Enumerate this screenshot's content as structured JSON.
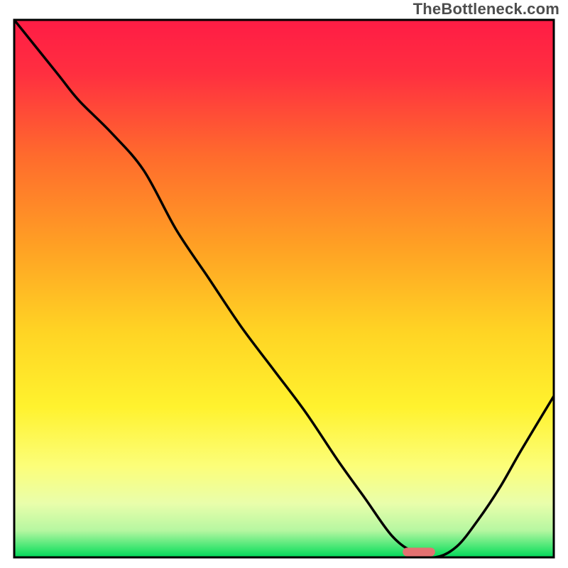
{
  "watermark": "TheBottleneck.com",
  "chart_data": {
    "type": "line",
    "title": "",
    "xlabel": "",
    "ylabel": "",
    "xlim": [
      0,
      100
    ],
    "ylim": [
      0,
      100
    ],
    "grid": false,
    "legend": false,
    "background": "vertical-gradient (top to bottom): red → orange → yellow → pale-yellow → pale-green → bright-green",
    "series": [
      {
        "name": "curve",
        "x": [
          0,
          8,
          12,
          18,
          24,
          30,
          36,
          42,
          48,
          54,
          60,
          65,
          70,
          74,
          78,
          82,
          86,
          90,
          94,
          100
        ],
        "values": [
          100,
          90,
          85,
          79,
          72,
          61,
          52,
          43,
          35,
          27,
          18,
          11,
          4,
          1,
          0,
          2,
          7,
          13,
          20,
          30
        ]
      }
    ],
    "marker": {
      "x_start": 72,
      "x_end": 78,
      "y": 1,
      "thickness": 1.6,
      "color": "#e47171"
    },
    "gradient_stops": [
      {
        "offset": 0.0,
        "color": "#ff1c45"
      },
      {
        "offset": 0.1,
        "color": "#ff2f40"
      },
      {
        "offset": 0.25,
        "color": "#ff6a2d"
      },
      {
        "offset": 0.42,
        "color": "#ffa024"
      },
      {
        "offset": 0.58,
        "color": "#ffd424"
      },
      {
        "offset": 0.72,
        "color": "#fff22e"
      },
      {
        "offset": 0.83,
        "color": "#fcfe79"
      },
      {
        "offset": 0.9,
        "color": "#e9feab"
      },
      {
        "offset": 0.95,
        "color": "#b6f7a1"
      },
      {
        "offset": 0.985,
        "color": "#36e46e"
      },
      {
        "offset": 1.0,
        "color": "#00d65a"
      }
    ]
  }
}
